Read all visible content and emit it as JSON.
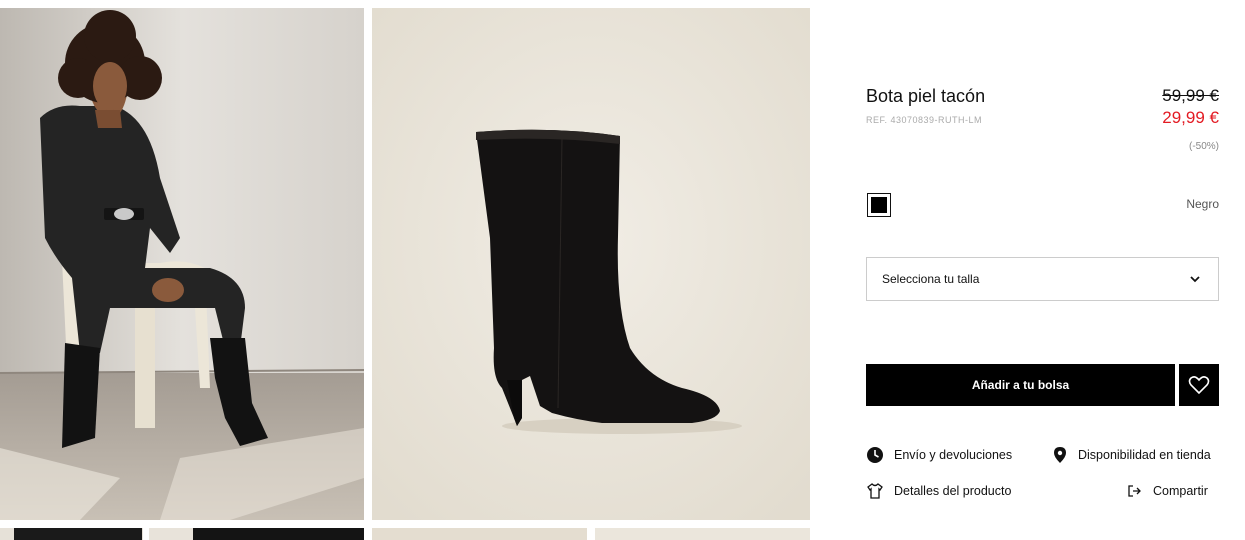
{
  "product": {
    "title": "Bota piel tacón",
    "ref": "REF. 43070839-RUTH-LM",
    "price_old": "59,99 €",
    "price_new": "29,99 €",
    "discount": "(-50%)"
  },
  "color": {
    "name": "Negro",
    "swatch": "#000000"
  },
  "size_select": {
    "label": "Selecciona tu talla"
  },
  "actions": {
    "add_to_bag": "Añadir a tu bolsa"
  },
  "links": {
    "shipping": "Envío y devoluciones",
    "store_availability": "Disponibilidad en tienda",
    "details": "Detalles del producto",
    "share": "Compartir"
  },
  "colors": {
    "sale_red": "#e31b23",
    "black": "#000000"
  },
  "icons": [
    "clock-icon",
    "location-pin-icon",
    "shirt-icon",
    "share-icon",
    "heart-icon",
    "chevron-down-icon"
  ]
}
